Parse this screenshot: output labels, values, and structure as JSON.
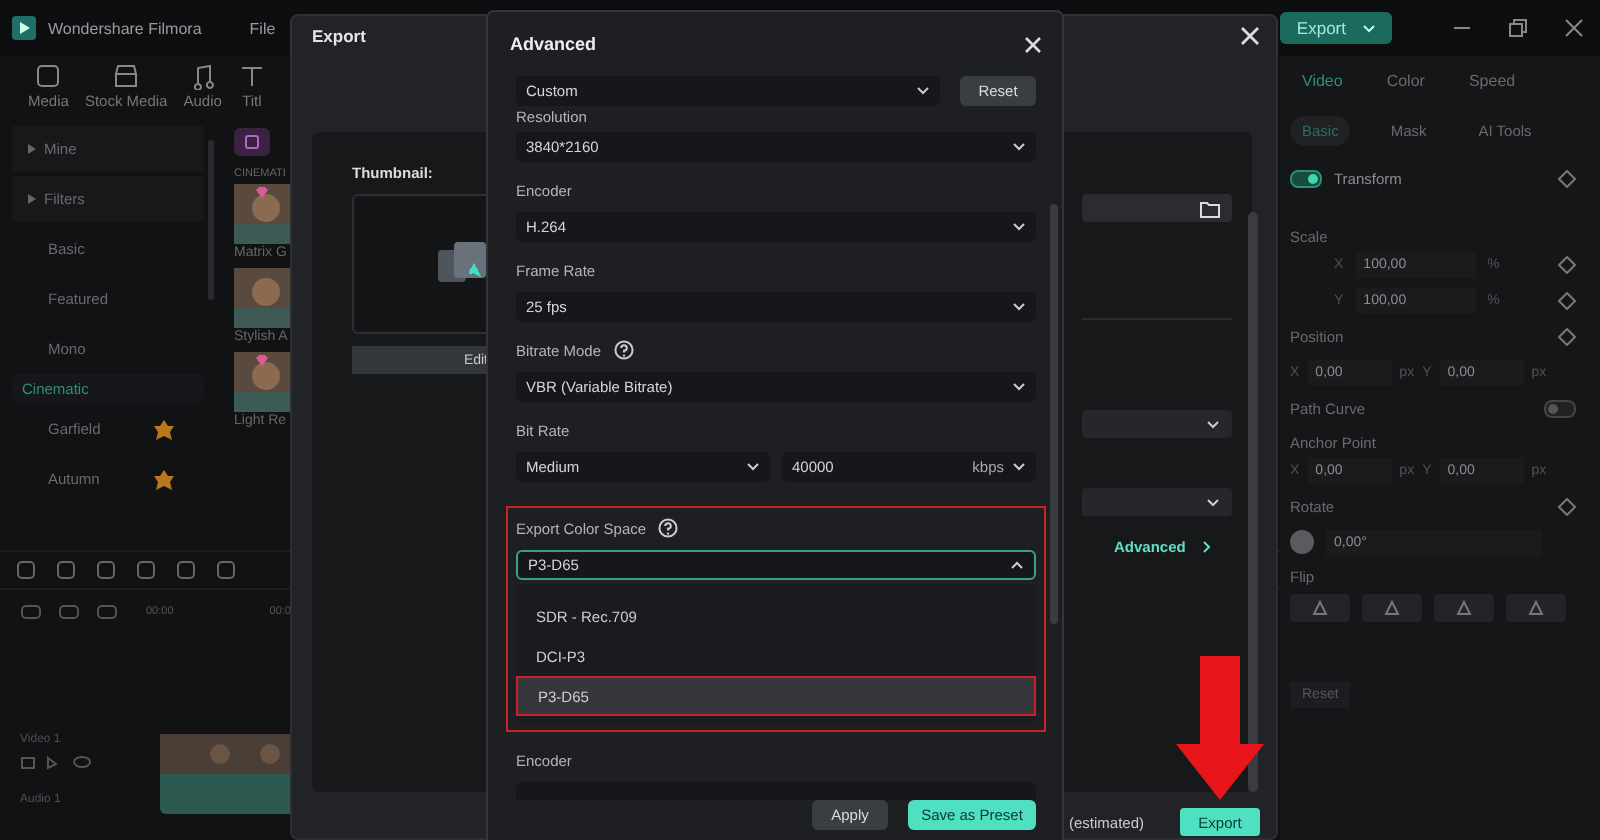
{
  "app": {
    "title": "Wondershare Filmora",
    "menu": [
      "File"
    ],
    "export_button": "Export"
  },
  "toolbar": [
    {
      "label": "Media",
      "kind": "media"
    },
    {
      "label": "Stock Media",
      "kind": "stock"
    },
    {
      "label": "Audio",
      "kind": "audio"
    },
    {
      "label": "Titl",
      "kind": "title"
    }
  ],
  "sidebar": [
    {
      "label": "Mine",
      "kind": "header",
      "selected": false
    },
    {
      "label": "Filters",
      "kind": "header",
      "selected": false
    },
    {
      "label": "Basic",
      "kind": "item",
      "selected": false
    },
    {
      "label": "Featured",
      "kind": "item",
      "selected": false
    },
    {
      "label": "Mono",
      "kind": "item",
      "selected": false
    },
    {
      "label": "Cinematic",
      "kind": "item",
      "selected": true
    },
    {
      "label": "Garfield",
      "kind": "leaf-item",
      "selected": false
    },
    {
      "label": "Autumn",
      "kind": "leaf-item",
      "selected": false
    }
  ],
  "library": {
    "section": "CINEMATI",
    "items": [
      {
        "label": "Matrix G",
        "premium": true
      },
      {
        "label": "Stylish A",
        "premium": false
      },
      {
        "label": "Light Re",
        "premium": true
      }
    ]
  },
  "timeline": {
    "ruler": [
      "00:00",
      "00:0"
    ],
    "tracks": [
      "Video 1",
      "Audio 1"
    ]
  },
  "properties": {
    "tabs": [
      {
        "label": "Video",
        "selected": true
      },
      {
        "label": "Color",
        "selected": false
      },
      {
        "label": "Speed",
        "selected": false
      }
    ],
    "subtabs": [
      {
        "label": "Basic",
        "selected": true
      },
      {
        "label": "Mask",
        "selected": false
      },
      {
        "label": "AI Tools",
        "selected": false
      }
    ],
    "transform": {
      "label": "Transform",
      "on": true
    },
    "scale": {
      "label": "Scale",
      "rows": [
        {
          "axis": "X",
          "value": "100,00",
          "unit": "%"
        },
        {
          "axis": "Y",
          "value": "100,00",
          "unit": "%"
        }
      ]
    },
    "position": {
      "label": "Position",
      "fields": [
        {
          "axis": "X",
          "value": "0,00",
          "unit": "px"
        },
        {
          "axis": "Y",
          "value": "0,00",
          "unit": "px"
        }
      ]
    },
    "path_curve": {
      "label": "Path Curve",
      "on": false
    },
    "anchor": {
      "label": "Anchor Point",
      "fields": [
        {
          "axis": "X",
          "value": "0,00",
          "unit": "px"
        },
        {
          "axis": "Y",
          "value": "0,00",
          "unit": "px"
        }
      ]
    },
    "rotate": {
      "label": "Rotate",
      "value": "0,00°"
    },
    "flip": {
      "label": "Flip"
    },
    "reset": "Reset"
  },
  "export_dialog": {
    "title": "Export",
    "thumbnail_label": "Thumbnail:",
    "edit_button": "Edit",
    "advanced_link": "Advanced",
    "size_note": "(estimated)",
    "export_button": "Export"
  },
  "advanced": {
    "title": "Advanced",
    "preset": "Custom",
    "reset": "Reset",
    "fields": [
      {
        "label": "Resolution",
        "value": "3840*2160",
        "help": false
      },
      {
        "label": "Encoder",
        "value": "H.264",
        "help": false
      },
      {
        "label": "Frame Rate",
        "value": "25 fps",
        "help": false
      },
      {
        "label": "Bitrate Mode",
        "value": "VBR (Variable Bitrate)",
        "help": true
      }
    ],
    "bit_rate": {
      "label": "Bit Rate",
      "quality": "Medium",
      "value": "40000",
      "unit": "kbps"
    },
    "color_space": {
      "label": "Export Color Space",
      "value": "P3-D65",
      "options": [
        {
          "label": "SDR - Rec.709",
          "selected": false
        },
        {
          "label": "DCI-P3",
          "selected": false
        },
        {
          "label": "P3-D65",
          "selected": true
        }
      ]
    },
    "next_label": "Encoder",
    "apply": "Apply",
    "save": "Save as Preset"
  }
}
